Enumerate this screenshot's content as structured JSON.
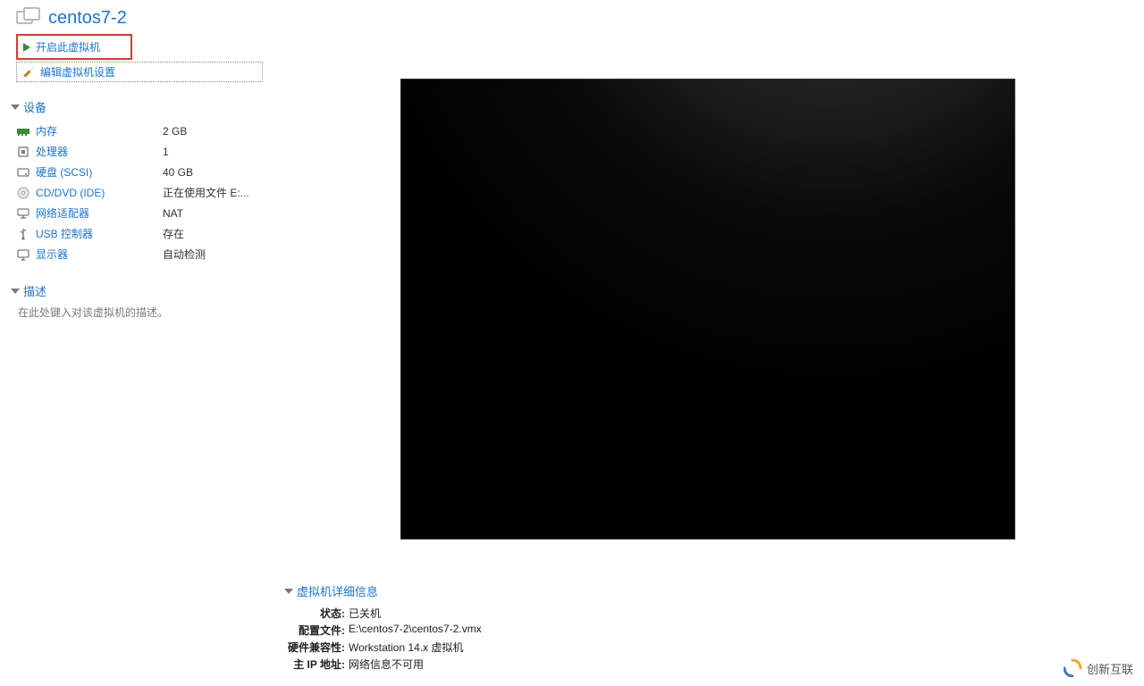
{
  "header": {
    "vm_name": "centos7-2"
  },
  "actions": {
    "start_label": "开启此虚拟机",
    "edit_label": "编辑虚拟机设置"
  },
  "sections": {
    "devices_title": "设备",
    "description_title": "描述",
    "details_title": "虚拟机详细信息"
  },
  "hardware": [
    {
      "icon": "memory-icon",
      "label": "内存",
      "value": "2 GB"
    },
    {
      "icon": "cpu-icon",
      "label": "处理器",
      "value": "1"
    },
    {
      "icon": "disk-icon",
      "label": "硬盘 (SCSI)",
      "value": "40 GB"
    },
    {
      "icon": "cd-icon",
      "label": "CD/DVD (IDE)",
      "value": "正在使用文件 E:..."
    },
    {
      "icon": "network-icon",
      "label": "网络适配器",
      "value": "NAT"
    },
    {
      "icon": "usb-icon",
      "label": "USB 控制器",
      "value": "存在"
    },
    {
      "icon": "display-icon",
      "label": "显示器",
      "value": "自动检测"
    }
  ],
  "description": {
    "placeholder": "在此处键入对该虚拟机的描述。"
  },
  "details": {
    "state_label": "状态:",
    "state_value": "已关机",
    "config_label": "配置文件:",
    "config_value": "E:\\centos7-2\\centos7-2.vmx",
    "compat_label": "硬件兼容性:",
    "compat_value": "Workstation 14.x 虚拟机",
    "ip_label": "主 IP 地址:",
    "ip_value": "网络信息不可用"
  },
  "watermark": {
    "text": "创新互联"
  }
}
